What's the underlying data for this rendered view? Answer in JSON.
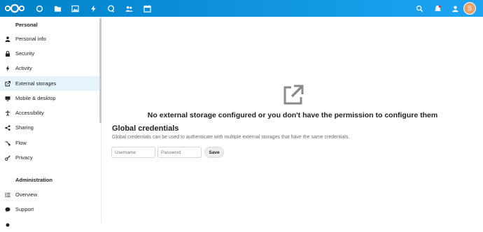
{
  "header": {
    "app_icons": [
      "dashboard-icon",
      "files-icon",
      "photos-icon",
      "activity-icon",
      "search-talk-icon",
      "contacts-icon",
      "calendar-icon"
    ],
    "right_icons": [
      "search-icon",
      "notifications-icon",
      "contacts-menu-icon"
    ],
    "avatar_letter": "S",
    "avatar_color": "#e8a36d",
    "brand_color": "#0082c9"
  },
  "sidebar": {
    "personal_title": "Personal",
    "personal_items": [
      {
        "label": "Personal info",
        "icon": "user-icon"
      },
      {
        "label": "Security",
        "icon": "lock-icon"
      },
      {
        "label": "Activity",
        "icon": "activity-icon"
      },
      {
        "label": "External storages",
        "icon": "external-link-icon",
        "active": true
      },
      {
        "label": "Mobile & desktop",
        "icon": "desktop-icon"
      },
      {
        "label": "Accessibility",
        "icon": "accessibility-icon"
      },
      {
        "label": "Sharing",
        "icon": "share-icon"
      },
      {
        "label": "Flow",
        "icon": "flow-icon"
      },
      {
        "label": "Privacy",
        "icon": "key-icon"
      }
    ],
    "admin_title": "Administration",
    "admin_items": [
      {
        "label": "Overview",
        "icon": "list-icon"
      },
      {
        "label": "Support",
        "icon": "support-icon"
      }
    ]
  },
  "main": {
    "empty_message": "No external storage configured or you don't have the permission to configure them",
    "global_credentials": {
      "title": "Global credentials",
      "description": "Global credentials can be used to authenticate with multiple external storages that have the same credentials.",
      "username_placeholder": "Username",
      "password_placeholder": "Password",
      "save_label": "Save"
    }
  }
}
